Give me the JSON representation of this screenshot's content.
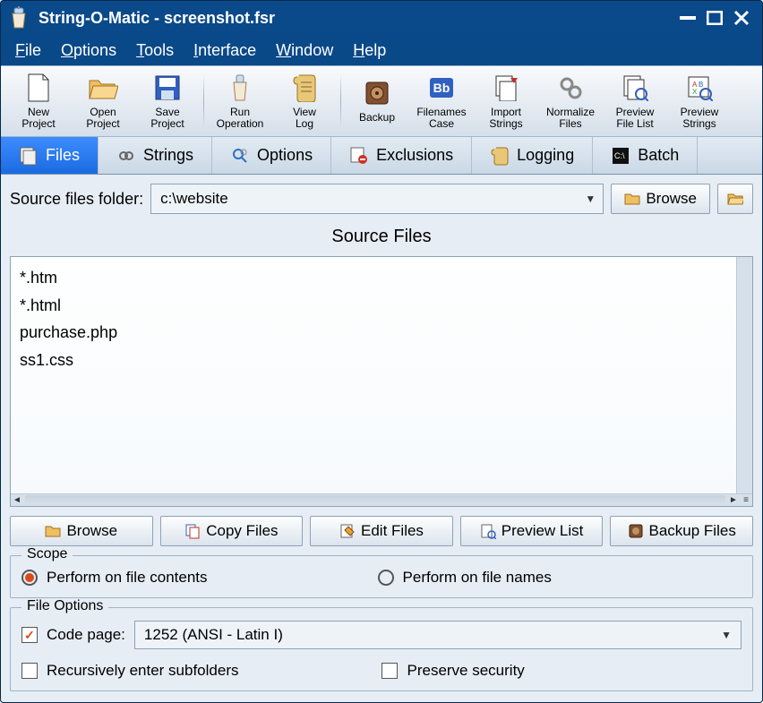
{
  "window": {
    "title": "String-O-Matic - screenshot.fsr"
  },
  "menu": {
    "file": "File",
    "options": "Options",
    "tools": "Tools",
    "interface": "Interface",
    "window": "Window",
    "help": "Help"
  },
  "toolbar": {
    "new_project": "New\nProject",
    "open_project": "Open\nProject",
    "save_project": "Save\nProject",
    "run_operation": "Run\nOperation",
    "view_log": "View\nLog",
    "backup": "Backup",
    "filenames_case": "Filenames\nCase",
    "import_strings": "Import\nStrings",
    "normalize_files": "Normalize\nFiles",
    "preview_filelist": "Preview\nFile List",
    "preview_strings": "Preview\nStrings"
  },
  "tabs": {
    "files": "Files",
    "strings": "Strings",
    "options": "Options",
    "exclusions": "Exclusions",
    "logging": "Logging",
    "batch": "Batch"
  },
  "source": {
    "label": "Source files folder:",
    "value": "c:\\website",
    "browse": "Browse"
  },
  "files_section": {
    "title": "Source Files",
    "items": [
      "*.htm",
      "*.html",
      "purchase.php",
      "ss1.css"
    ]
  },
  "actions": {
    "browse": "Browse",
    "copy_files": "Copy Files",
    "edit_files": "Edit Files",
    "preview_list": "Preview List",
    "backup_files": "Backup Files"
  },
  "scope": {
    "legend": "Scope",
    "contents": "Perform on file contents",
    "names": "Perform on file names"
  },
  "file_options": {
    "legend": "File Options",
    "code_page_label": "Code page:",
    "code_page_value": "1252 (ANSI - Latin I)",
    "recurse": "Recursively enter subfolders",
    "preserve": "Preserve security"
  }
}
